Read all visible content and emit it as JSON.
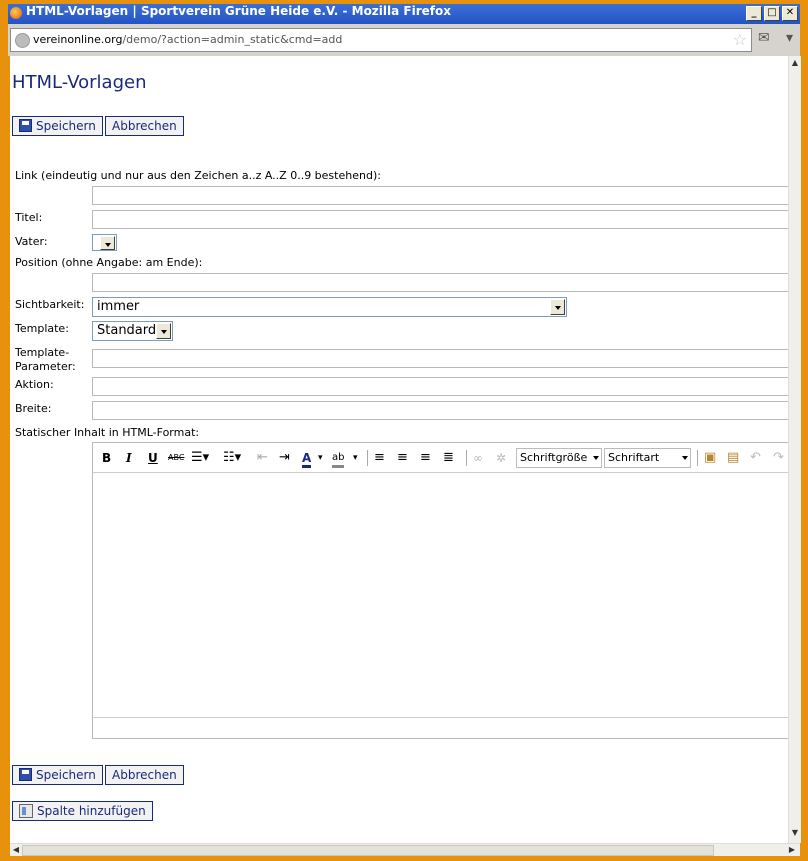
{
  "window": {
    "title": "HTML-Vorlagen | Sportverein Grüne Heide e.V. - Mozilla Firefox",
    "url_host": "vereinonline.org",
    "url_path": "/demo/?action=admin_static&cmd=add"
  },
  "page": {
    "title": "HTML-Vorlagen",
    "save_label": "Speichern",
    "cancel_label": "Abbrechen",
    "add_column_label": "Spalte hinzufügen"
  },
  "form": {
    "link_label": "Link (eindeutig und nur aus den Zeichen a..z A..Z 0..9 bestehend):",
    "title_label": "Titel:",
    "parent_label": "Vater:",
    "position_label": "Position (ohne Angabe: am Ende):",
    "visibility_label": "Sichtbarkeit:",
    "visibility_value": "immer",
    "template_label": "Template:",
    "template_value": "Standard",
    "template_params_label_1": "Template-",
    "template_params_label_2": "Parameter:",
    "action_label": "Aktion:",
    "width_label": "Breite:",
    "content_label": "Statischer Inhalt in HTML-Format:"
  },
  "editor": {
    "bold": "B",
    "italic": "I",
    "underline": "U",
    "strike": "ABC",
    "font_color": "A",
    "highlight": "ab",
    "font_size_label": "Schriftgröße",
    "font_family_label": "Schriftart"
  }
}
